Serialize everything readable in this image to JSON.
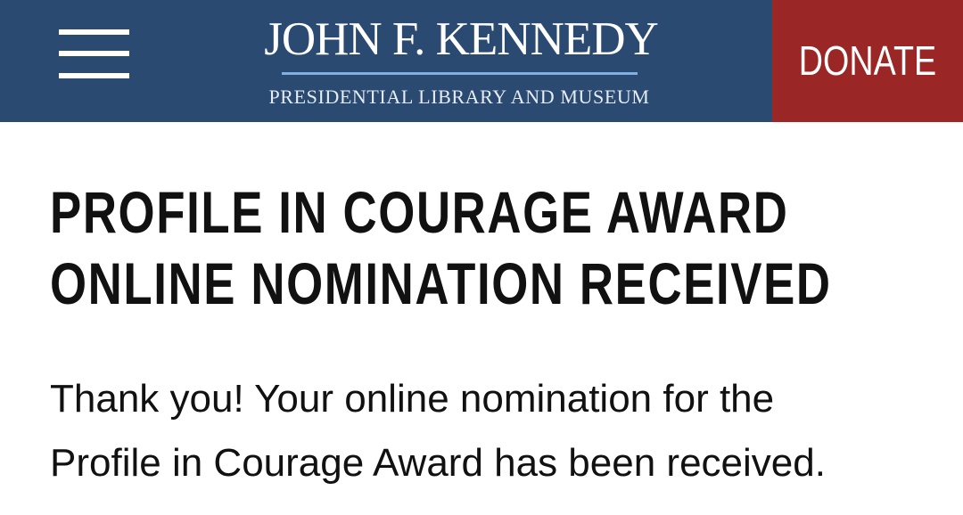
{
  "header": {
    "menu_icon": "hamburger-menu-icon",
    "logo": {
      "title": "JOHN F. KENNEDY",
      "subtitle": "PRESIDENTIAL LIBRARY AND MUSEUM"
    },
    "donate_label": "DONATE"
  },
  "main": {
    "title_lines": [
      "PROFILE IN COURAGE AWARD",
      "ONLINE NOMINATION RECEIVED"
    ],
    "message_lines": [
      "Thank you! Your online nomination for the",
      "Profile in Courage Award has been received."
    ]
  },
  "colors": {
    "header_background": "#2b4a72",
    "donate_background": "#9a2626",
    "logo_rule": "#7fb1e3",
    "text": "#111111"
  }
}
